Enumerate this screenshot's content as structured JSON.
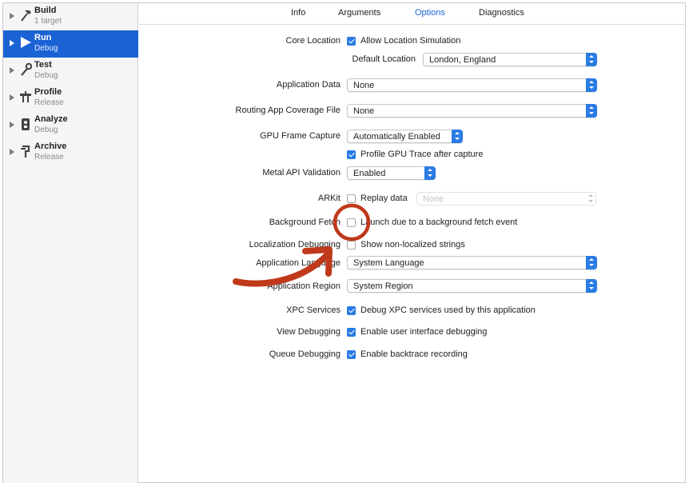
{
  "sidebar": {
    "items": [
      {
        "name": "Build",
        "sub": "1 target"
      },
      {
        "name": "Run",
        "sub": "Debug"
      },
      {
        "name": "Test",
        "sub": "Debug"
      },
      {
        "name": "Profile",
        "sub": "Release"
      },
      {
        "name": "Analyze",
        "sub": "Debug"
      },
      {
        "name": "Archive",
        "sub": "Release"
      }
    ],
    "selected_index": 1
  },
  "tabs": [
    {
      "label": "Info"
    },
    {
      "label": "Arguments"
    },
    {
      "label": "Options"
    },
    {
      "label": "Diagnostics"
    }
  ],
  "active_tab": "Options",
  "options": {
    "core_location": {
      "label": "Core Location",
      "checkbox_label": "Allow Location Simulation",
      "checked": true
    },
    "default_location": {
      "label": "Default Location",
      "value": "London, England"
    },
    "application_data": {
      "label": "Application Data",
      "value": "None"
    },
    "routing_coverage": {
      "label": "Routing App Coverage File",
      "value": "None"
    },
    "gpu_frame_capture": {
      "label": "GPU Frame Capture",
      "value": "Automatically Enabled"
    },
    "profile_gpu": {
      "checkbox_label": "Profile GPU Trace after capture",
      "checked": true
    },
    "metal_validation": {
      "label": "Metal API Validation",
      "value": "Enabled"
    },
    "arkit": {
      "label": "ARKit",
      "checkbox_label": "Replay data",
      "checked": false,
      "value": "None"
    },
    "background_fetch": {
      "label": "Background Fetch",
      "checkbox_label": "Launch due to a background fetch event",
      "checked": false
    },
    "localization_debugging": {
      "label": "Localization Debugging",
      "checkbox_label": "Show non-localized strings",
      "checked": false
    },
    "application_language": {
      "label": "Application Language",
      "value": "System Language"
    },
    "application_region": {
      "label": "Application Region",
      "value": "System Region"
    },
    "xpc_services": {
      "label": "XPC Services",
      "checkbox_label": "Debug XPC services used by this application",
      "checked": true
    },
    "view_debugging": {
      "label": "View Debugging",
      "checkbox_label": "Enable user interface debugging",
      "checked": true
    },
    "queue_debugging": {
      "label": "Queue Debugging",
      "checkbox_label": "Enable backtrace recording",
      "checked": true
    }
  },
  "colors": {
    "accent": "#1b63d5",
    "checkbox_blue": "#2a7be4",
    "annotation_red": "#c0391b"
  },
  "icons": {
    "build": "hammer-icon",
    "run": "play-icon",
    "test": "wrench-icon",
    "profile": "instruments-icon",
    "analyze": "analyze-icon",
    "archive": "archive-icon"
  }
}
